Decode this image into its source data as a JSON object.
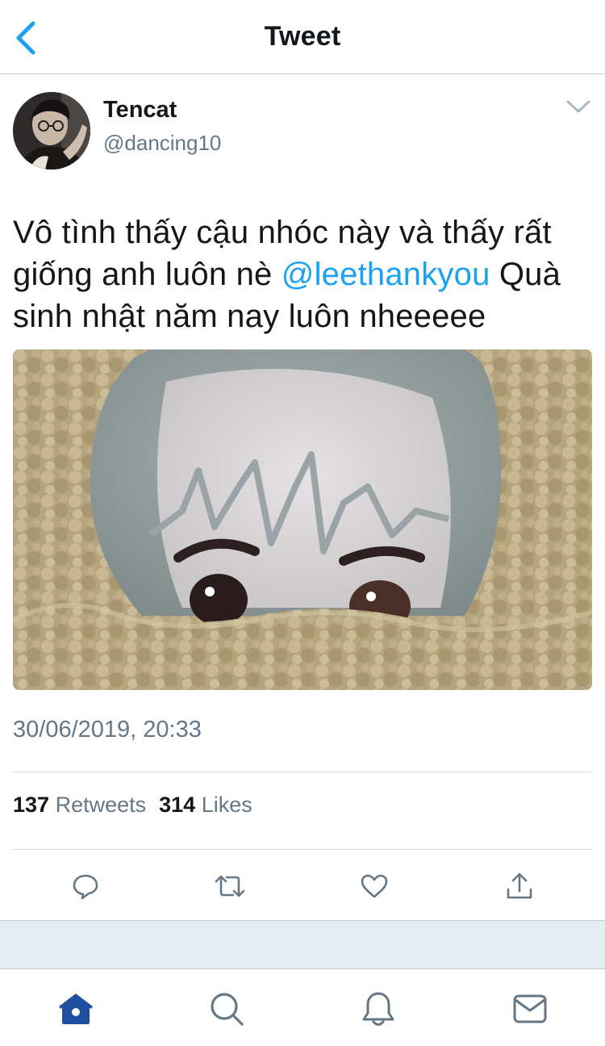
{
  "nav": {
    "title": "Tweet",
    "back_icon": "chevron-left-icon"
  },
  "author": {
    "name": "Tencat",
    "handle": "@dancing10",
    "menu_icon": "chevron-down-icon"
  },
  "tweet": {
    "text_before": "Vô tình thấy cậu nhóc này và thấy rất giống anh luôn nè ",
    "mention": "@leethankyou",
    "text_after": " Quà sinh nhật năm nay luôn nheeeee",
    "timestamp": "30/06/2019, 20:33"
  },
  "stats": {
    "retweets_count": "137",
    "retweets_label": "Retweets",
    "likes_count": "314",
    "likes_label": "Likes"
  },
  "actions": [
    "reply-icon",
    "retweet-icon",
    "like-icon",
    "share-icon"
  ],
  "tabbar": [
    "home-icon",
    "search-icon",
    "notifications-icon",
    "messages-icon"
  ],
  "colors": {
    "accent": "#1da1f2",
    "secondary_text": "#657786",
    "active_tab": "#1f4fa0",
    "icon_gray": "#657786"
  }
}
